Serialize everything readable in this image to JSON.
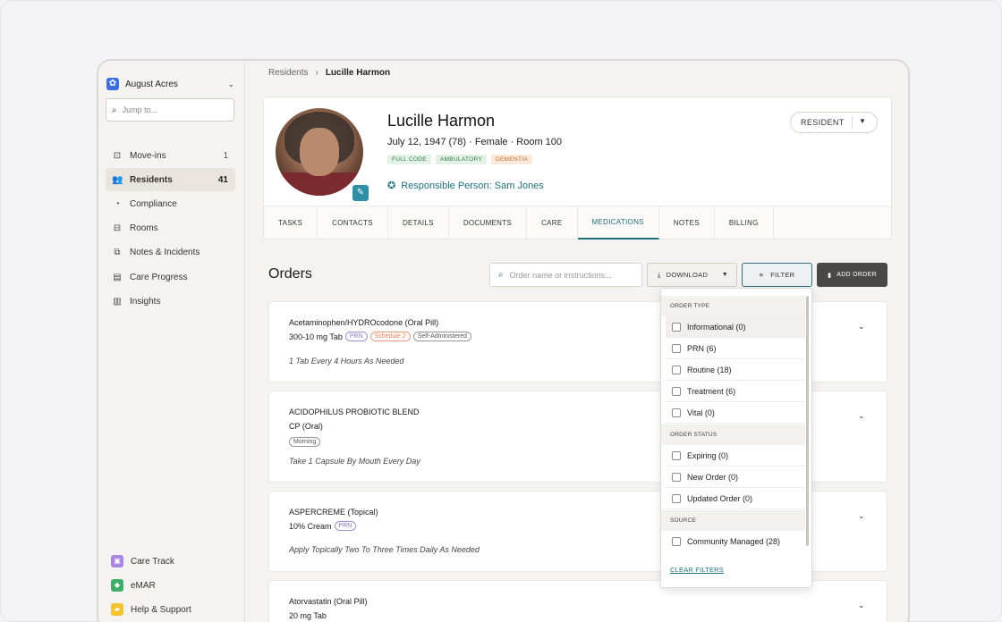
{
  "sidebar": {
    "org_name": "August Acres",
    "jump_placeholder": "Jump to...",
    "items": [
      {
        "label": "Move-ins",
        "count": "1"
      },
      {
        "label": "Residents",
        "count": "41"
      },
      {
        "label": "Compliance",
        "count": ""
      },
      {
        "label": "Rooms",
        "count": ""
      },
      {
        "label": "Notes & Incidents",
        "count": ""
      },
      {
        "label": "Care Progress",
        "count": ""
      },
      {
        "label": "Insights",
        "count": ""
      }
    ],
    "bottom": [
      {
        "label": "Care Track",
        "color": "#a985e0"
      },
      {
        "label": "eMAR",
        "color": "#3fae69"
      },
      {
        "label": "Help & Support",
        "color": "#f2c230"
      }
    ]
  },
  "breadcrumb": {
    "parent": "Residents",
    "current": "Lucille Harmon"
  },
  "resident": {
    "name": "Lucille Harmon",
    "info": "July 12, 1947 (78)  ·  Female  ·  Room 100",
    "tags": [
      "FULL CODE",
      "AMBULATORY",
      "DEMENTIA"
    ],
    "responsible": "Responsible Person: Sam Jones",
    "role_button": "RESIDENT"
  },
  "tabs": [
    "TASKS",
    "CONTACTS",
    "DETAILS",
    "DOCUMENTS",
    "CARE",
    "MEDICATIONS",
    "NOTES",
    "BILLING"
  ],
  "active_tab": "MEDICATIONS",
  "orders": {
    "heading": "Orders",
    "search_placeholder": "Order name or instructions...",
    "download_label": "DOWNLOAD",
    "filter_label": "FILTER",
    "add_label": "ADD ORDER",
    "items": [
      {
        "name": "Acetaminophen/HYDROcodone (Oral Pill)",
        "dose": "300-10 mg Tab",
        "pills": [
          "PRN",
          "Schedule 2",
          "Self-Administered"
        ],
        "sig": "1 Tab Every 4 Hours As Needed"
      },
      {
        "name": "ACIDOPHILUS PROBIOTIC BLEND",
        "dose": "CP (Oral)",
        "pills": [
          "Morning"
        ],
        "sig": "Take 1 Capsule By Mouth Every Day"
      },
      {
        "name": "ASPERCREME (Topical)",
        "dose": "10% Cream",
        "pills": [
          "PRN"
        ],
        "sig": "Apply Topically Two To Three Times Daily As Needed"
      },
      {
        "name": "Atorvastatin (Oral Pill)",
        "dose": "20 mg Tab",
        "pills": [],
        "sig": ""
      }
    ]
  },
  "filter_panel": {
    "sections": [
      {
        "title": "ORDER TYPE",
        "options": [
          "Informational (0)",
          "PRN (6)",
          "Routine (18)",
          "Treatment (6)",
          "Vital (0)"
        ]
      },
      {
        "title": "ORDER STATUS",
        "options": [
          "Expiring (0)",
          "New Order (0)",
          "Updated Order (0)"
        ]
      },
      {
        "title": "SOURCE",
        "options": [
          "Community Managed (28)"
        ]
      }
    ],
    "clear_label": "CLEAR FILTERS"
  }
}
